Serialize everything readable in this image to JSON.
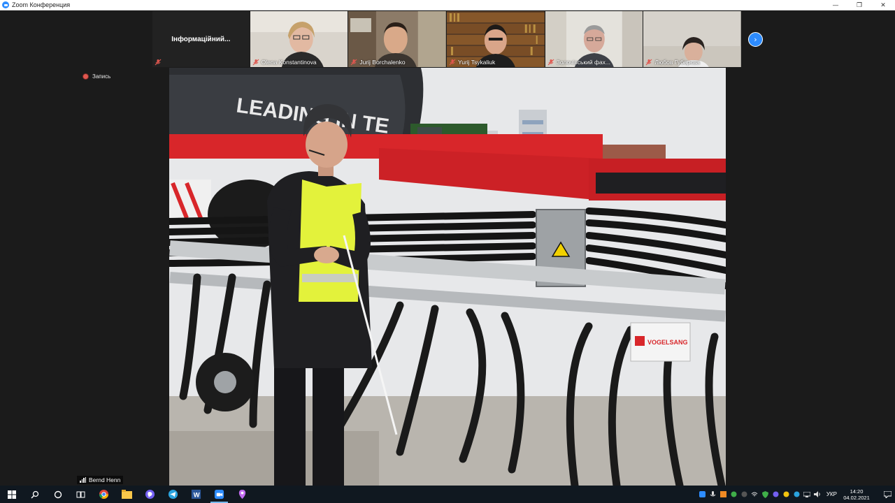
{
  "window": {
    "title": "Zoom Конференция",
    "minimize": "—",
    "restore": "❐",
    "close": "✕"
  },
  "recording": {
    "label": "Запись"
  },
  "thumbnails": {
    "info_tile": "Інформаційний...",
    "participants": [
      {
        "name": "Olena Konstantinova",
        "muted": true
      },
      {
        "name": "Jurij Borchalenko",
        "muted": true
      },
      {
        "name": "Yurij Tsykaliuk",
        "muted": true
      },
      {
        "name": "Золочівський фах...",
        "muted": true
      },
      {
        "name": "Любов Губарєва",
        "muted": true
      }
    ],
    "next_button": "›"
  },
  "active_speaker": {
    "name": "Bernd Henn"
  },
  "main_video": {
    "tanker_text": "LEADING IN TE",
    "brand_plate": "VOGELSANG"
  },
  "taskbar": {
    "apps": [
      "windows-start-icon",
      "search-icon",
      "cortana-icon",
      "task-view-icon",
      "chrome-icon",
      "file-explorer-icon",
      "viber-icon",
      "telegram-icon",
      "word-icon",
      "zoom-icon",
      "maps-icon"
    ],
    "language": "УКР",
    "time": "14:20",
    "date": "04.02.2021"
  },
  "colors": {
    "zoom_blue": "#2d8cff",
    "machine_red": "#d8262a",
    "vest_yellow": "#e3f23b",
    "taskbar_bg": "#101820"
  }
}
